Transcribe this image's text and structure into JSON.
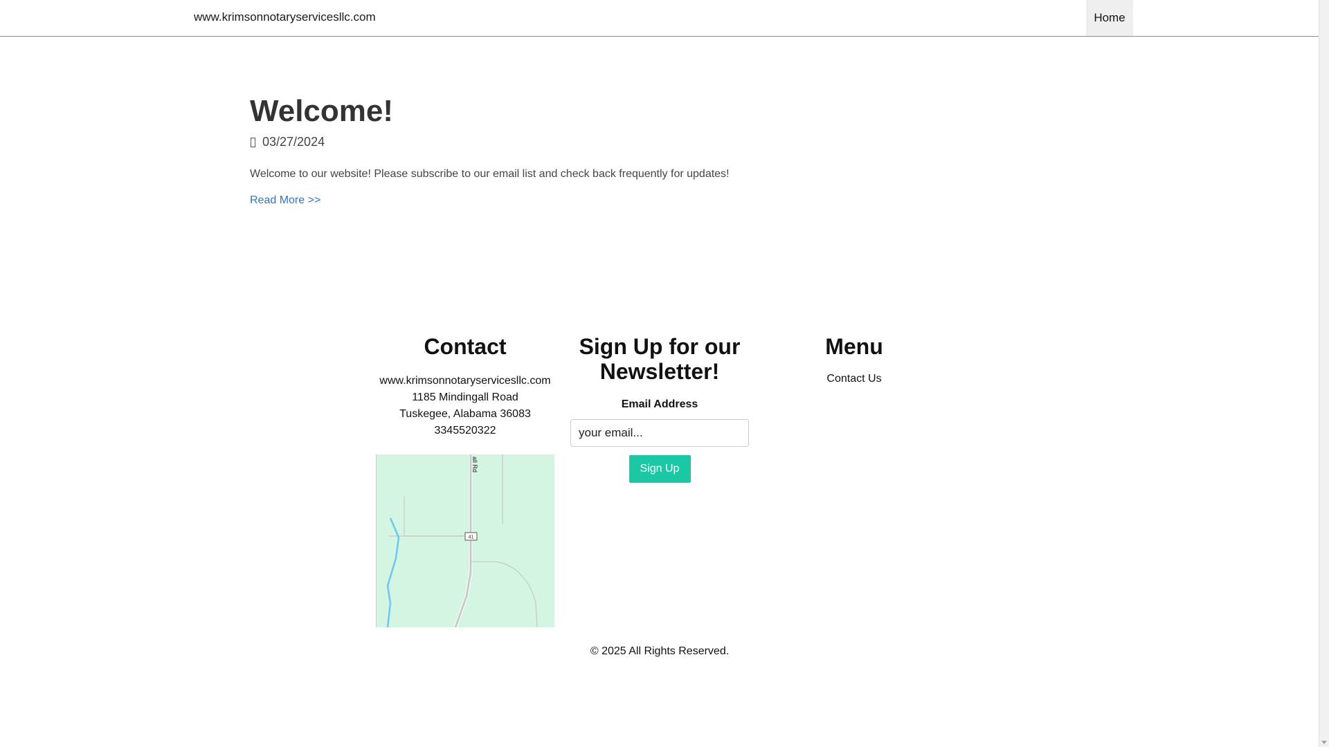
{
  "header": {
    "brand": "www.krimsonnotaryservicesllc.com",
    "nav": {
      "home": "Home"
    }
  },
  "post": {
    "title": "Welcome!",
    "date": "03/27/2024",
    "body": "Welcome to our website! Please subscribe to our email list and check back frequently for updates!",
    "read_more": "Read More >>"
  },
  "footer": {
    "contact": {
      "heading": "Contact",
      "website": "www.krimsonnotaryservicesllc.com",
      "street": "1185 Mindingall Road",
      "city": "Tuskegee, Alabama 36083",
      "phone": "3345520322",
      "map": {
        "road_label": "all Rd",
        "route_shield": "41"
      }
    },
    "newsletter": {
      "heading": "Sign Up for our Newsletter!",
      "email_label": "Email Address",
      "email_placeholder": "your email...",
      "signup_label": "Sign Up"
    },
    "menu": {
      "heading": "Menu",
      "items": [
        "Contact Us"
      ]
    },
    "copyright": "© 2025 All Rights Reserved."
  },
  "colors": {
    "accent": "#1ac8a6",
    "link": "#2f76c8",
    "map_land": "#d3f5e1",
    "map_water": "#6cc7f2"
  }
}
